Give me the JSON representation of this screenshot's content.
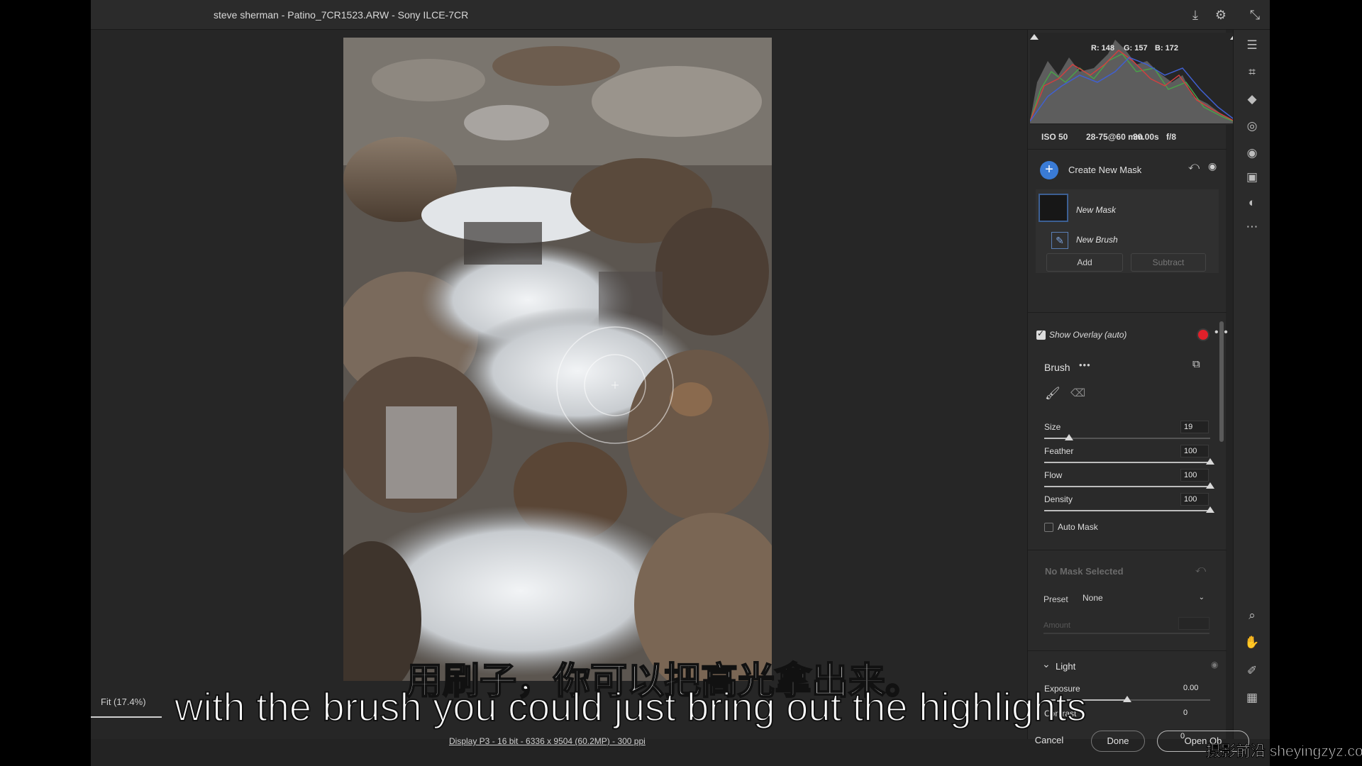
{
  "window": {
    "title": "steve sherman - Patino_7CR1523.ARW  -  Sony ILCE-7CR"
  },
  "histogram": {
    "r": "R: 148",
    "g": "G: 157",
    "b": "B: 172"
  },
  "exif": {
    "iso": "ISO 50",
    "lens": "28-75@60 mm",
    "aperture": "f/8",
    "shutter": "30.00s"
  },
  "masks": {
    "create_label": "Create New Mask",
    "mask_name": "New Mask",
    "brush_name": "New Brush",
    "add_label": "Add",
    "subtract_label": "Subtract",
    "show_overlay_label": "Show Overlay (auto)",
    "show_overlay_checked": true,
    "overlay_color": "#e0202a"
  },
  "brush": {
    "title": "Brush",
    "sliders": [
      {
        "label": "Size",
        "value": "19",
        "level": 0.15
      },
      {
        "label": "Feather",
        "value": "100",
        "level": 1.0
      },
      {
        "label": "Flow",
        "value": "100",
        "level": 1.0
      },
      {
        "label": "Density",
        "value": "100",
        "level": 1.0
      }
    ],
    "auto_mask_label": "Auto Mask",
    "auto_mask_checked": false
  },
  "adjust": {
    "no_mask_title": "No Mask Selected",
    "preset_label": "Preset",
    "preset_value": "None",
    "amount_label": "Amount"
  },
  "light": {
    "title": "Light",
    "exposure_label": "Exposure",
    "exposure_value": "0.00",
    "exposure_level": 0.5,
    "contrast_label": "Contrast",
    "contrast_value": "0",
    "third_value": "0"
  },
  "footer": {
    "zoom": "Fit (17.4%)",
    "display_info": "Display P3 - 16 bit - 6336 x 9504 (60.2MP) - 300 ppi",
    "cancel": "Cancel",
    "done": "Done",
    "open": "Open Ob"
  },
  "subtitles": {
    "chinese": "用刷子，你可以把高光拿出来。",
    "english": "with the brush you could just bring out the highlights"
  },
  "watermark": "摄影前沿 sheyingzyz.com",
  "colors": {
    "accent": "#3a7bd5",
    "panel": "#2a2a2a",
    "background": "#232323"
  }
}
